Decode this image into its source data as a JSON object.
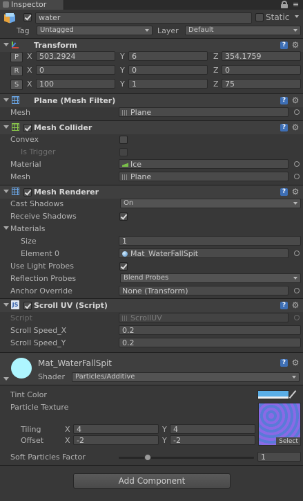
{
  "tab": {
    "title": "Inspector"
  },
  "object": {
    "name": "water",
    "static_label": "Static",
    "tag_label": "Tag",
    "tag_value": "Untagged",
    "layer_label": "Layer",
    "layer_value": "Default"
  },
  "transform": {
    "title": "Transform",
    "axis_x": "X",
    "axis_y": "Y",
    "axis_z": "Z",
    "position": {
      "btn": "P",
      "x": "503.2924",
      "y": "6",
      "z": "354.1759"
    },
    "rotation": {
      "btn": "R",
      "x": "0",
      "y": "0",
      "z": "0"
    },
    "scale": {
      "btn": "S",
      "x": "100",
      "y": "1",
      "z": "75"
    }
  },
  "mesh_filter": {
    "title": "Plane (Mesh Filter)",
    "mesh_label": "Mesh",
    "mesh_value": "Plane"
  },
  "mesh_collider": {
    "title": "Mesh Collider",
    "convex_label": "Convex",
    "trigger_label": "Is Trigger",
    "material_label": "Material",
    "material_value": "Ice",
    "mesh_label": "Mesh",
    "mesh_value": "Plane"
  },
  "mesh_renderer": {
    "title": "Mesh Renderer",
    "cast_label": "Cast Shadows",
    "cast_value": "On",
    "receive_label": "Receive Shadows",
    "materials_label": "Materials",
    "size_label": "Size",
    "size_value": "1",
    "element_label": "Element 0",
    "element_value": "Mat_WaterFallSpit",
    "probes_label": "Use Light Probes",
    "reflection_label": "Reflection Probes",
    "reflection_value": "Blend Probes",
    "anchor_label": "Anchor Override",
    "anchor_value": "None (Transform)"
  },
  "scroll_uv": {
    "title": "Scroll UV (Script)",
    "script_label": "Script",
    "script_value": "ScrollUV",
    "speed_x_label": "Scroll Speed_X",
    "speed_x_value": "0.2",
    "speed_y_label": "Scroll Speed_Y",
    "speed_y_value": "0.2"
  },
  "material": {
    "name": "Mat_WaterFallSpit",
    "shader_label": "Shader",
    "shader_value": "Particles/Additive",
    "tint_label": "Tint Color",
    "tint_color": "#5aaee6",
    "texture_label": "Particle Texture",
    "tiling_label": "Tiling",
    "tiling_x": "4",
    "tiling_y": "4",
    "offset_label": "Offset",
    "offset_x": "-2",
    "offset_y": "-2",
    "axis_x": "X",
    "axis_y": "Y",
    "select_label": "Select",
    "soft_label": "Soft Particles Factor",
    "soft_value": "1",
    "soft_fraction": 0.215
  },
  "add_component": {
    "label": "Add Component"
  },
  "colors": {
    "background": "#383838",
    "header": "#3f3f3f",
    "accent": "#3e6fb5"
  }
}
